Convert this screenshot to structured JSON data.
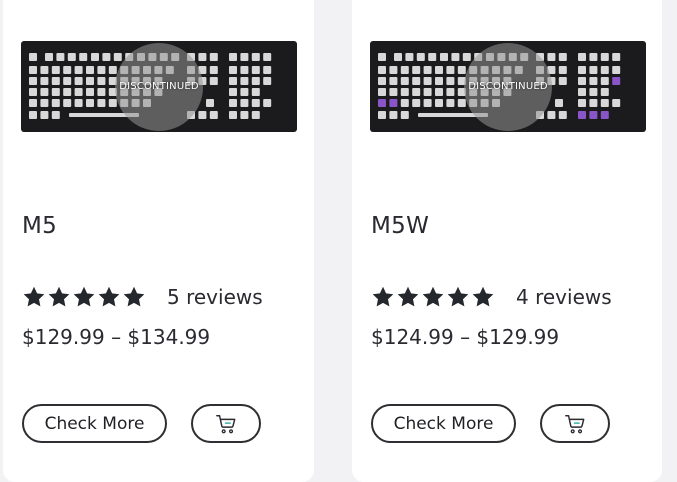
{
  "products": [
    {
      "name": "M5",
      "badge": "DISCONTINUED",
      "rating_stars": 5,
      "reviews": "5 reviews",
      "price": "$129.99 – $134.99",
      "check_label": "Check More",
      "cart_icon": "cart-plus-icon",
      "accent_keys": false
    },
    {
      "name": "M5W",
      "badge": "DISCONTINUED",
      "rating_stars": 5,
      "reviews": "4 reviews",
      "price": "$124.99 – $129.99",
      "check_label": "Check More",
      "cart_icon": "cart-plus-icon",
      "accent_keys": true
    }
  ],
  "colors": {
    "page_bg": "#f2f2f4",
    "card_bg": "#ffffff",
    "text": "#2a2a30",
    "keyboard_body": "#1b1b1d",
    "keycap": "#d8d8d8",
    "accent_key": "#8a55c8",
    "cart_accent": "#38b2a8"
  }
}
